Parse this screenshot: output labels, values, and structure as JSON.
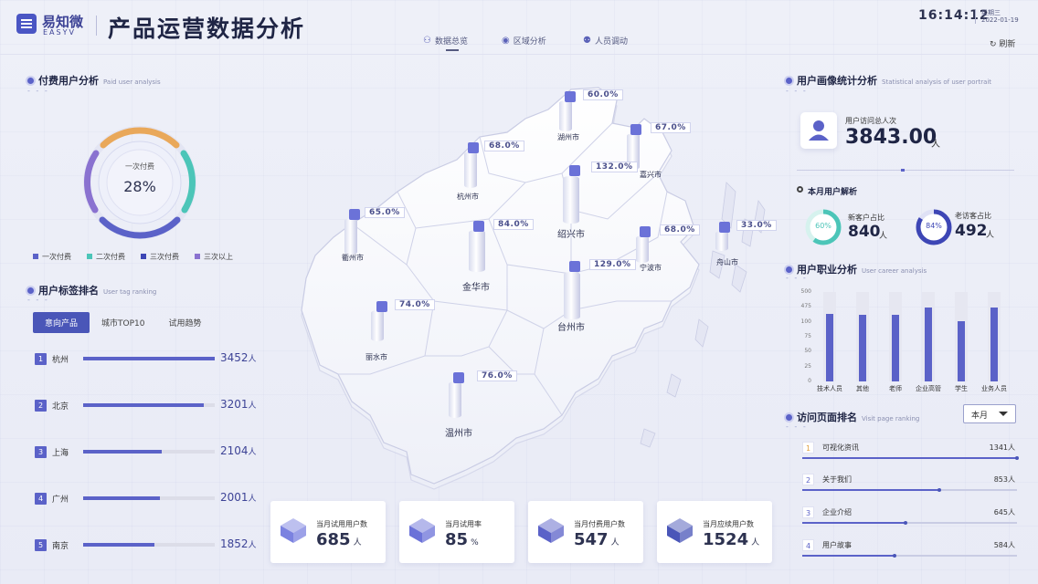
{
  "brand": {
    "cn": "易知微",
    "en": "EASYV"
  },
  "app_title": "产品运营数据分析",
  "nav": [
    {
      "label": "数据总览",
      "icon": "chart-icon"
    },
    {
      "label": "区域分析",
      "icon": "location-icon"
    },
    {
      "label": "人员调动",
      "icon": "users-icon"
    }
  ],
  "clock": {
    "time": "16:14:12",
    "weekday": "星期三",
    "date": "2022-01-19"
  },
  "refresh_label": "刷新",
  "paid_users": {
    "title": "付费用户分析",
    "subtitle": "Paid user analysis",
    "center_label": "一次付费",
    "center_value": "28%",
    "legend": [
      {
        "label": "一次付费",
        "color": "#5b62c8"
      },
      {
        "label": "二次付费",
        "color": "#4cc5b8"
      },
      {
        "label": "三次付费",
        "color": "#3d46b5"
      },
      {
        "label": "三次以上",
        "color": "#8a72d0"
      }
    ]
  },
  "user_tags": {
    "title": "用户标签排名",
    "subtitle": "User tag ranking",
    "tabs": [
      "意向产品",
      "城市TOP10",
      "试用趋势"
    ],
    "unit": "人",
    "rows": [
      {
        "rank": "1",
        "city": "杭州",
        "value": "3452",
        "fill": 1.0
      },
      {
        "rank": "2",
        "city": "北京",
        "value": "3201",
        "fill": 0.92
      },
      {
        "rank": "3",
        "city": "上海",
        "value": "2104",
        "fill": 0.6
      },
      {
        "rank": "4",
        "city": "广州",
        "value": "2001",
        "fill": 0.58
      },
      {
        "rank": "5",
        "city": "南京",
        "value": "1852",
        "fill": 0.54
      }
    ]
  },
  "map": {
    "cities": [
      "湖州市",
      "嘉兴市",
      "杭州市",
      "绍兴市",
      "衢州市",
      "宁波市",
      "舟山市",
      "金华市",
      "台州市",
      "丽水市",
      "温州市"
    ],
    "percents": [
      "60.0%",
      "67.0%",
      "68.0%",
      "132.0%",
      "65.0%",
      "84.0%",
      "68.0%",
      "33.0%",
      "129.0%",
      "74.0%",
      "76.0%"
    ]
  },
  "cards": [
    {
      "label": "当月试用用户数",
      "value": "685",
      "unit": "人"
    },
    {
      "label": "当月试用率",
      "value": "85",
      "unit": "%"
    },
    {
      "label": "当月付费用户数",
      "value": "547",
      "unit": "人"
    },
    {
      "label": "当月应续用户数",
      "value": "1524",
      "unit": "人"
    }
  ],
  "portrait": {
    "title": "用户画像统计分析",
    "subtitle": "Statistical analysis of user portrait",
    "visits_label": "用户访问总人次",
    "visits_value": "3843.00",
    "visits_unit": "人",
    "monthly_title": "本月用户解析",
    "new_label": "新客户占比",
    "new_pct": "60%",
    "new_value": "840",
    "old_label": "老访客占比",
    "old_pct": "84%",
    "old_value": "492",
    "unit": "人"
  },
  "career": {
    "title": "用户职业分析",
    "subtitle": "User career analysis"
  },
  "chart_data": {
    "type": "bar",
    "categories": [
      "技术人员",
      "其他",
      "老师",
      "企业高管",
      "学生",
      "业务人员"
    ],
    "values": [
      180,
      178,
      178,
      196,
      160,
      197
    ],
    "ylim": [
      0,
      500
    ],
    "yticks": [
      "500",
      "475",
      "100",
      "75",
      "50",
      "25",
      "0"
    ]
  },
  "visit_pages": {
    "title": "访问页面排名",
    "subtitle": "Visit page ranking",
    "select_value": "本月",
    "rows": [
      {
        "rank": "1",
        "name": "可视化资讯",
        "value": "1341人",
        "fill": 1.0
      },
      {
        "rank": "2",
        "name": "关于我们",
        "value": "853人",
        "fill": 0.64
      },
      {
        "rank": "3",
        "name": "企业介绍",
        "value": "645人",
        "fill": 0.48
      },
      {
        "rank": "4",
        "name": "用户故事",
        "value": "584人",
        "fill": 0.43
      }
    ]
  }
}
